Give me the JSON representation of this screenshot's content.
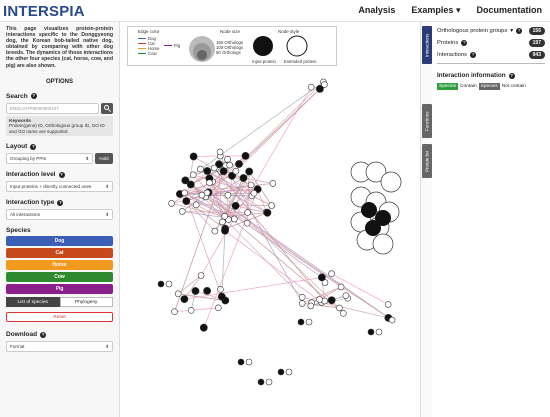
{
  "brand": "INTERSPIA",
  "nav": {
    "analysis": "Analysis",
    "examples": "Examples",
    "documentation": "Documentation"
  },
  "intro": "This page visualizes protein-protein interactions specific to the Donggyeong dog, the Korean bob-tailed native dog, obtained by comparing with other dog breeds. The dynamics of those interactions the other four species (cat, horse, cow, and pig) are also shown.",
  "options_title": "OPTIONS",
  "search": {
    "label": "Search",
    "placeholder": "ENSCAFP00000000107",
    "hint_title": "Keywords",
    "hint_text": "Protein(gene) ID, Orthologous group ID, GO ID and GO name are supported."
  },
  "layout": {
    "label": "Layout",
    "value": "Grouping by PPIs",
    "hold": "Hold"
  },
  "interaction_level": {
    "label": "Interaction level",
    "value": "Input proteins + directly connected ones"
  },
  "interaction_type": {
    "label": "Interaction type",
    "value": "All interactions"
  },
  "species": {
    "label": "Species",
    "items": [
      {
        "name": "Dog",
        "color": "#3b5fb5"
      },
      {
        "name": "Cat",
        "color": "#c64a1b"
      },
      {
        "name": "Horse",
        "color": "#f29a1e"
      },
      {
        "name": "Cow",
        "color": "#2e8a2e"
      },
      {
        "name": "Pig",
        "color": "#8a1e8a"
      }
    ]
  },
  "species_toggle": {
    "list": "List of species",
    "phylogeny": "Phylogeny"
  },
  "reset": "Reset",
  "download": {
    "label": "Download",
    "value": "Format"
  },
  "legend": {
    "edge_color": "Edge color",
    "edges": [
      {
        "name": "Dog",
        "color": "#3b5fb5"
      },
      {
        "name": "Cat",
        "color": "#c64a1b"
      },
      {
        "name": "Horse",
        "color": "#f29a1e"
      },
      {
        "name": "Cow",
        "color": "#2e8a2e"
      },
      {
        "name": "Pig",
        "color": "#8a1e8a"
      }
    ],
    "node_size": "Node size",
    "sizes": [
      "150 Orthologs",
      "100 Orthologs",
      "50 Orthologs"
    ],
    "node_style": "Node style",
    "input": "Input protein",
    "extended": "Extended protein"
  },
  "tabs": [
    "Interactions",
    "Functions",
    "Protein list"
  ],
  "stats": {
    "orthologous_groups": {
      "label": "Orthologous protein groups",
      "value": "156"
    },
    "proteins": {
      "label": "Proteins",
      "value": "197"
    },
    "interactions": {
      "label": "Interactions",
      "value": "943"
    }
  },
  "interaction_info": {
    "title": "Interaction information",
    "species_tag": "Species",
    "contain": "Contain",
    "not_contain": "Not contain"
  }
}
